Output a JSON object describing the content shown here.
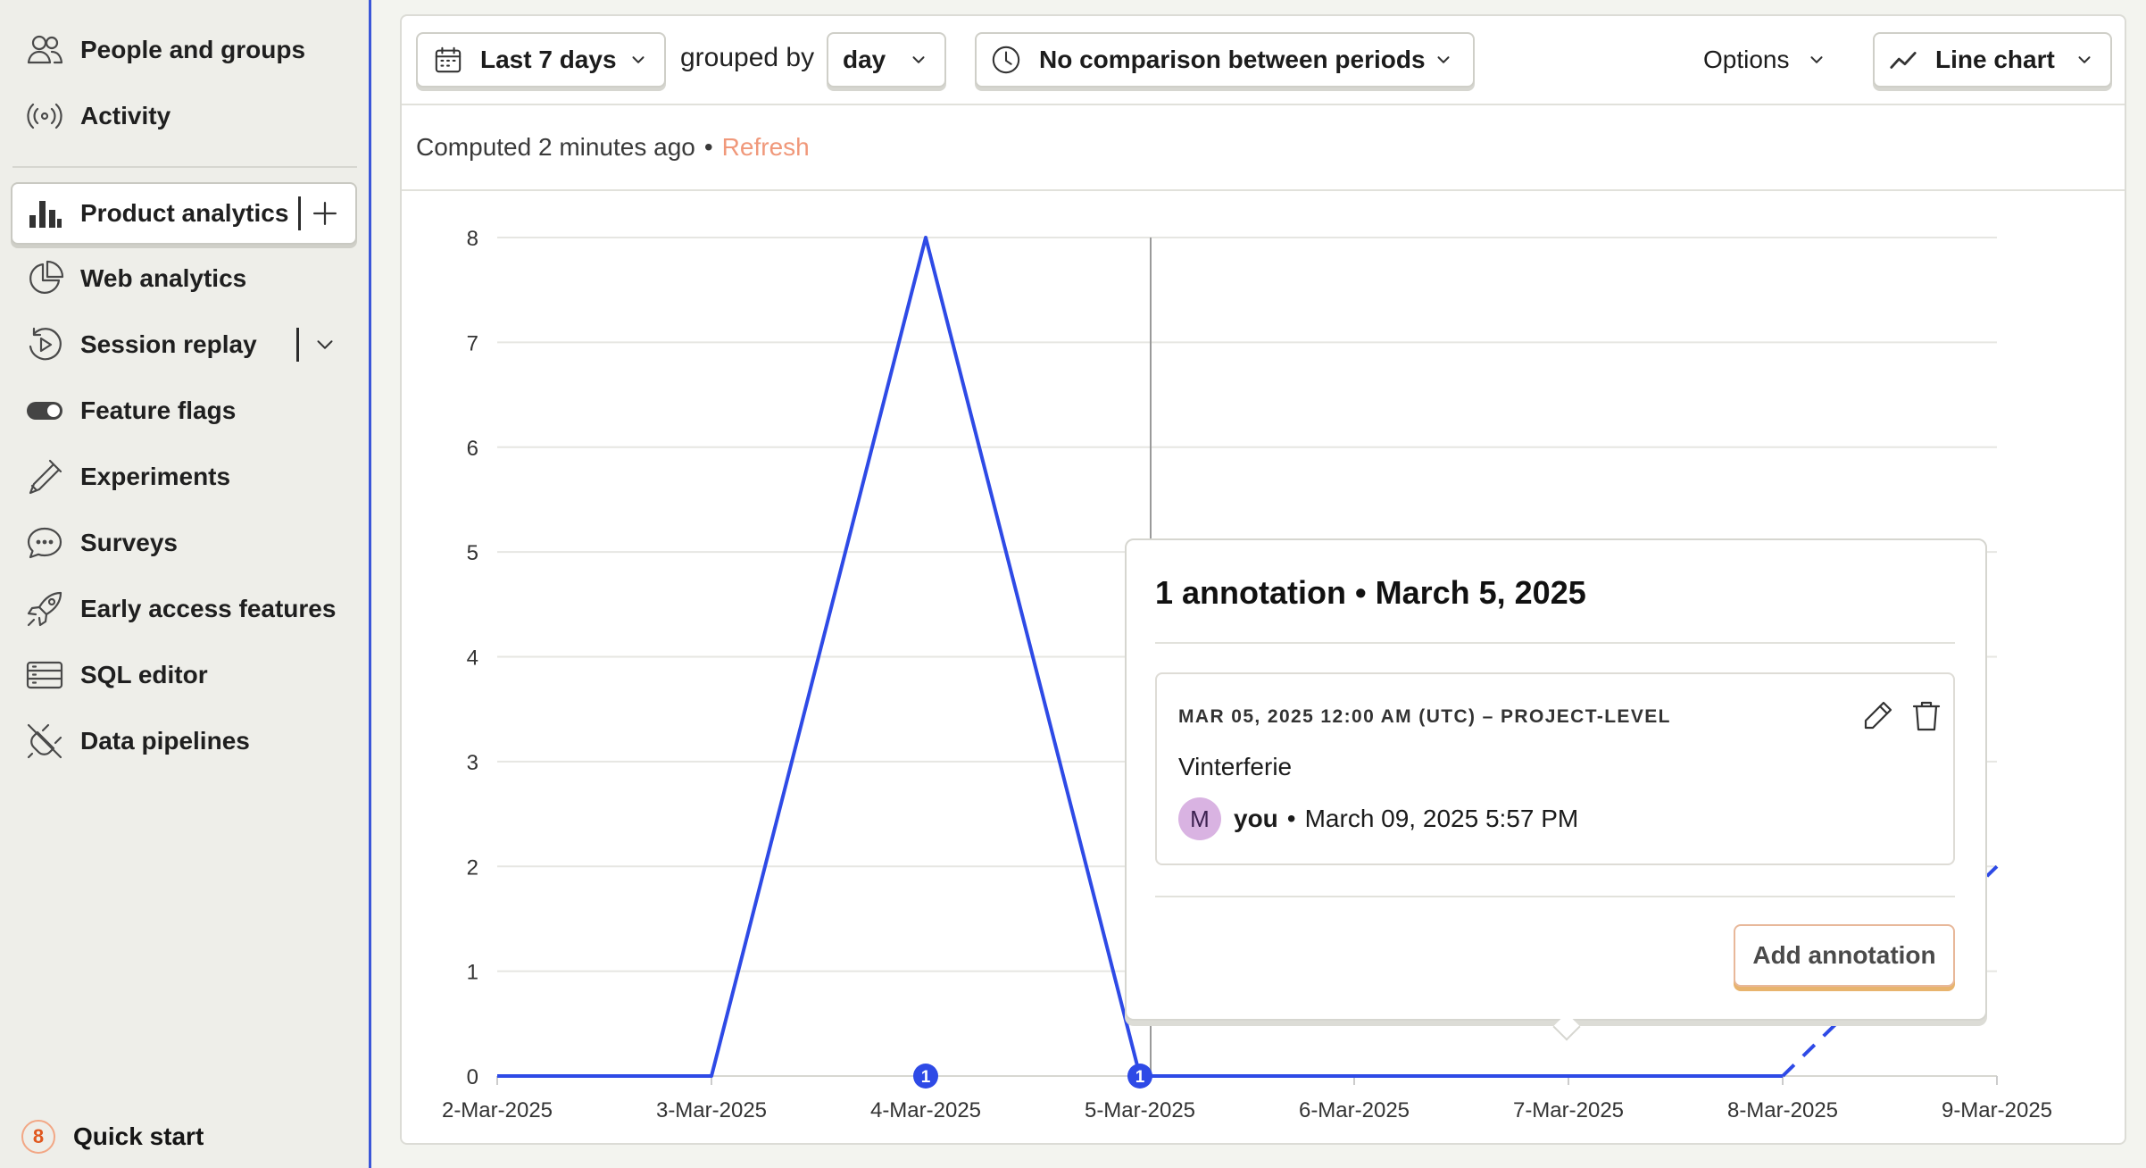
{
  "sidebar": {
    "items": [
      {
        "label": "People and groups",
        "icon": "people-icon"
      },
      {
        "label": "Activity",
        "icon": "activity-icon"
      },
      {
        "label": "Product analytics",
        "icon": "bar-chart-icon"
      },
      {
        "label": "Web analytics",
        "icon": "pie-chart-icon"
      },
      {
        "label": "Session replay",
        "icon": "replay-icon"
      },
      {
        "label": "Feature flags",
        "icon": "toggle-icon"
      },
      {
        "label": "Experiments",
        "icon": "flask-icon"
      },
      {
        "label": "Surveys",
        "icon": "chat-icon"
      },
      {
        "label": "Early access features",
        "icon": "rocket-icon"
      },
      {
        "label": "SQL editor",
        "icon": "database-icon"
      },
      {
        "label": "Data pipelines",
        "icon": "plug-icon"
      }
    ],
    "quick_start": {
      "label": "Quick start",
      "count": "8"
    }
  },
  "toolbar": {
    "date_range": "Last 7 days",
    "grouped_by_label": "grouped by",
    "interval": "day",
    "comparison": "No comparison between periods",
    "options": "Options",
    "chart_type": "Line chart"
  },
  "status": {
    "computed": "Computed 2 minutes ago",
    "separator": "•",
    "refresh": "Refresh"
  },
  "chart_data": {
    "type": "line",
    "x": [
      "2-Mar-2025",
      "3-Mar-2025",
      "4-Mar-2025",
      "5-Mar-2025",
      "6-Mar-2025",
      "7-Mar-2025",
      "8-Mar-2025",
      "9-Mar-2025"
    ],
    "series": [
      {
        "values": [
          0,
          0,
          8,
          0,
          0,
          0,
          0,
          2
        ],
        "color": "#2e4ae6",
        "dashed_last_segment": true
      }
    ],
    "ylim": [
      0,
      8
    ],
    "yticks": [
      "0",
      "1",
      "2",
      "3",
      "4",
      "5",
      "6",
      "7",
      "8"
    ],
    "grid": true,
    "annotation_markers": [
      {
        "x": "4-Mar-2025",
        "count": "1"
      },
      {
        "x": "5-Mar-2025",
        "count": "1"
      }
    ],
    "hover_x": "5-Mar-2025"
  },
  "popover": {
    "title": "1 annotation • March 5, 2025",
    "annotation": {
      "meta": "MAR 05, 2025 12:00 AM (UTC) – PROJECT-LEVEL",
      "text": "Vinterferie",
      "avatar_letter": "M",
      "author": "you",
      "separator": "•",
      "date": "March 09, 2025 5:57 PM"
    },
    "add_button": "Add annotation"
  }
}
